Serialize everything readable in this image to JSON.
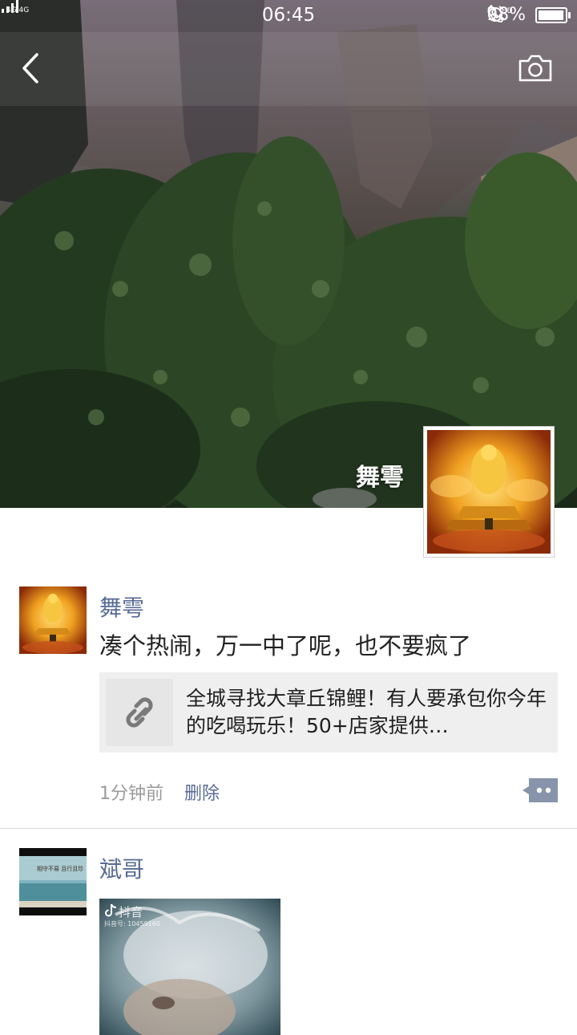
{
  "status_bar": {
    "network": "4G 4G",
    "time": "06:45",
    "battery_percent": "98%",
    "battery_level": 0.98,
    "icons": [
      "signal-icon",
      "alarm-icon",
      "hd-call-icon",
      "battery-icon"
    ]
  },
  "header": {
    "back_icon": "chevron-left-icon",
    "camera_icon": "camera-icon"
  },
  "cover": {
    "user_name": "舞雩"
  },
  "posts": [
    {
      "name": "舞雩",
      "text": "凑个热闹，万一中了呢，也不要疯了",
      "link": {
        "icon": "link-icon",
        "title": "全城寻找大章丘锦鲤！有人要承包你今年的吃喝玩乐！50+店家提供…"
      },
      "time": "1分钟前",
      "delete_label": "删除",
      "comment_icon": "comment-dots-icon"
    },
    {
      "name": "斌哥",
      "avatar_text": "相守不易 且行且珍",
      "video": {
        "watermark": "抖音",
        "id_text": "抖音号: 10459160"
      }
    }
  ],
  "colors": {
    "name_link": "#576b95",
    "text": "#222222",
    "card_bg": "#efefef",
    "muted": "#9a9a9a"
  }
}
